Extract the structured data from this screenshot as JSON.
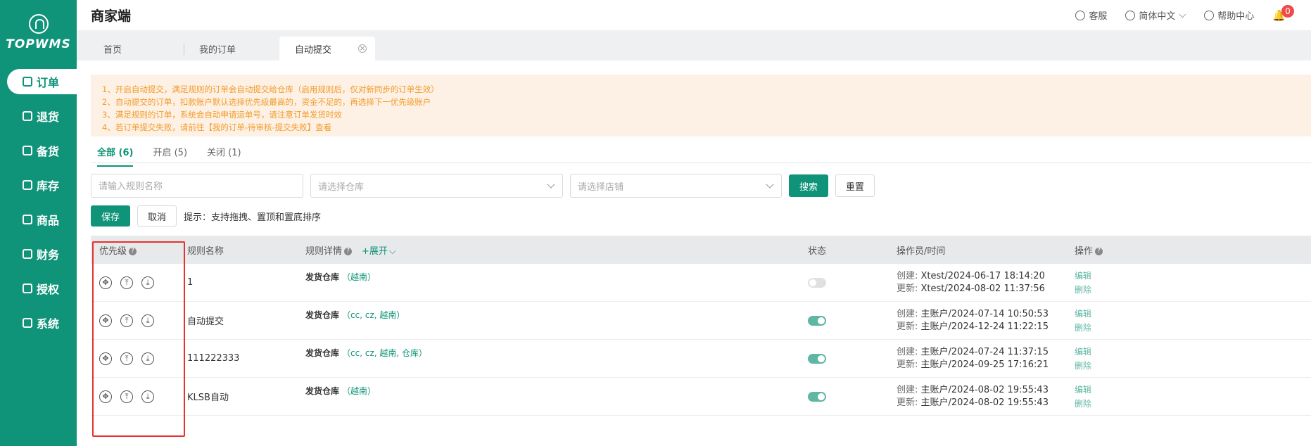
{
  "sidebar": {
    "logo_text": "TOPWMS",
    "items": [
      {
        "label": "订单",
        "icon": "order-icon",
        "active": true
      },
      {
        "label": "退货",
        "icon": "return-icon",
        "active": false
      },
      {
        "label": "备货",
        "icon": "stock-icon",
        "active": false
      },
      {
        "label": "库存",
        "icon": "inventory-icon",
        "active": false
      },
      {
        "label": "商品",
        "icon": "goods-icon",
        "active": false
      },
      {
        "label": "财务",
        "icon": "finance-icon",
        "active": false
      },
      {
        "label": "授权",
        "icon": "auth-icon",
        "active": false
      },
      {
        "label": "系统",
        "icon": "system-icon",
        "active": false
      }
    ]
  },
  "header": {
    "title": "商家端",
    "service": "客服",
    "language": "简体中文",
    "help": "帮助中心",
    "notification_count": "0"
  },
  "tabs": [
    {
      "label": "首页",
      "active": false
    },
    {
      "label": "我的订单",
      "active": false
    },
    {
      "label": "自动提交",
      "active": true,
      "close": "×"
    }
  ],
  "notice": {
    "lines": [
      "1、开启自动提交，满足规则的订单会自动提交给仓库（启用规则后，仅对新同步的订单生效）",
      "2、自动提交的订单，扣款账户默认选择优先级最高的，资金不足的，再选择下一优先级账户",
      "3、满足规则的订单，系统会自动申请运单号，请注意订单发货时效",
      "4、若订单提交失败，请前往【我的订单-待审核-提交失败】查看"
    ]
  },
  "subtabs": [
    {
      "label": "全部 (6)",
      "active": true
    },
    {
      "label": "开启 (5)",
      "active": false
    },
    {
      "label": "关闭 (1)",
      "active": false
    }
  ],
  "filters": {
    "rule_name_placeholder": "请输入规则名称",
    "warehouse_placeholder": "请选择仓库",
    "shop_placeholder": "请选择店铺",
    "search_label": "搜索",
    "reset_label": "重置"
  },
  "actions": {
    "save_label": "保存",
    "cancel_label": "取消",
    "hint": "提示：支持拖拽、置顶和置底排序"
  },
  "table": {
    "headers": {
      "priority": "优先级",
      "rule_name": "规则名称",
      "rule_detail": "规则详情",
      "expand": "+展开",
      "status": "状态",
      "operator_time": "操作员/时间",
      "operation": "操作"
    },
    "detail_label": "发货仓库",
    "created_label": "创建:",
    "updated_label": "更新:",
    "edit_label": "编辑",
    "delete_label": "删除",
    "rows": [
      {
        "name": "1",
        "warehouses": "（越南）",
        "enabled": false,
        "created": "Xtest/2024-06-17 18:14:20",
        "updated": "Xtest/2024-08-02 11:37:56"
      },
      {
        "name": "自动提交",
        "warehouses": "（cc, cz, 越南）",
        "enabled": true,
        "created": "主账户/2024-07-14 10:50:53",
        "updated": "主账户/2024-12-24 11:22:15"
      },
      {
        "name": "111222333",
        "warehouses": "（cc, cz, 越南, 仓库）",
        "enabled": true,
        "created": "主账户/2024-07-24 11:37:15",
        "updated": "主账户/2024-09-25 17:16:21"
      },
      {
        "name": "KLSB自动",
        "warehouses": "（越南）",
        "enabled": true,
        "created": "主账户/2024-08-02 19:55:43",
        "updated": "主账户/2024-08-02 19:55:43"
      }
    ]
  }
}
